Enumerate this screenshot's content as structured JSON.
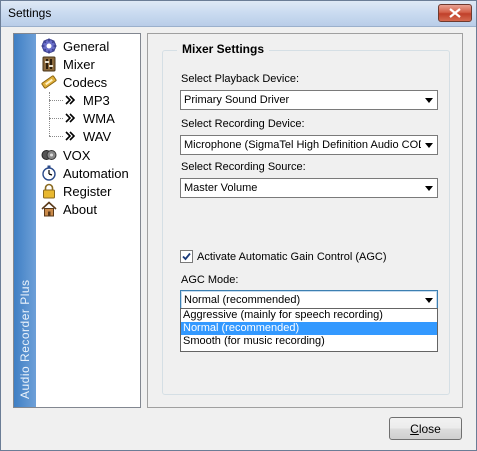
{
  "window": {
    "title": "Settings"
  },
  "nav": {
    "brand": "Audio Recorder Plus",
    "items": [
      {
        "label": "General",
        "icon": "gear-icon"
      },
      {
        "label": "Mixer",
        "icon": "mixer-icon"
      },
      {
        "label": "Codecs",
        "icon": "codecs-icon"
      },
      {
        "label": "MP3",
        "icon": "arrow-icon"
      },
      {
        "label": "WMA",
        "icon": "arrow-icon"
      },
      {
        "label": "WAV",
        "icon": "arrow-icon"
      },
      {
        "label": "VOX",
        "icon": "vox-icon"
      },
      {
        "label": "Automation",
        "icon": "stopwatch-icon"
      },
      {
        "label": "Register",
        "icon": "lock-icon"
      },
      {
        "label": "About",
        "icon": "home-icon"
      }
    ]
  },
  "mixer": {
    "group_title": "Mixer Settings",
    "playback_label": "Select Playback Device:",
    "playback_value": "Primary Sound Driver",
    "recording_label": "Select Recording Device:",
    "recording_value": "Microphone (SigmaTel High Definition Audio CODEC)",
    "source_label": "Select Recording Source:",
    "source_value": "Master Volume",
    "agc_checkbox_label": "Activate Automatic Gain Control (AGC)",
    "agc_checked": true,
    "agc_mode_label": "AGC Mode:",
    "agc_mode_value": "Normal (recommended)",
    "agc_options": [
      "Aggressive (mainly for speech recording)",
      "Normal (recommended)",
      "Smooth (for music recording)"
    ],
    "agc_selected_index": 1
  },
  "footer": {
    "close_label_underlined": "C",
    "close_label_rest": "lose"
  },
  "colors": {
    "selection": "#3399ff",
    "brand_strip": "#3f7fc4",
    "close_button": "#c0402a"
  }
}
